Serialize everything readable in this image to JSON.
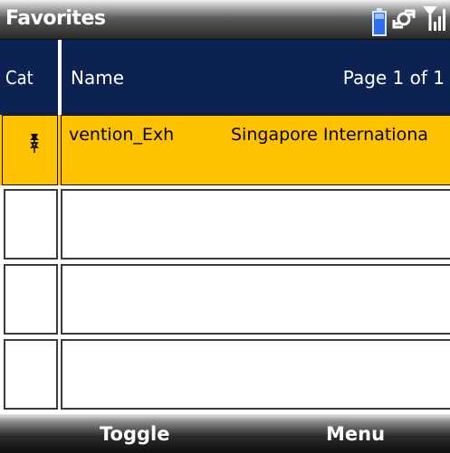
{
  "titlebar": {
    "title": "Favorites",
    "icons": [
      "battery-icon",
      "connection-icon",
      "signal-icon"
    ]
  },
  "header": {
    "cat_label": "Cat",
    "name_label": "Name",
    "page_label": "Page 1 of 1"
  },
  "rows": [
    {
      "name": "vention_Exh",
      "location": "Singapore Internationa",
      "icon": "pushpin-icon",
      "selected": true
    },
    {
      "name": "",
      "location": ""
    },
    {
      "name": "",
      "location": ""
    },
    {
      "name": "",
      "location": ""
    }
  ],
  "softkeys": {
    "left": "Toggle",
    "right": "Menu"
  },
  "colors": {
    "header_bg": "#0c2253",
    "selected_bg": "#ffc200"
  }
}
